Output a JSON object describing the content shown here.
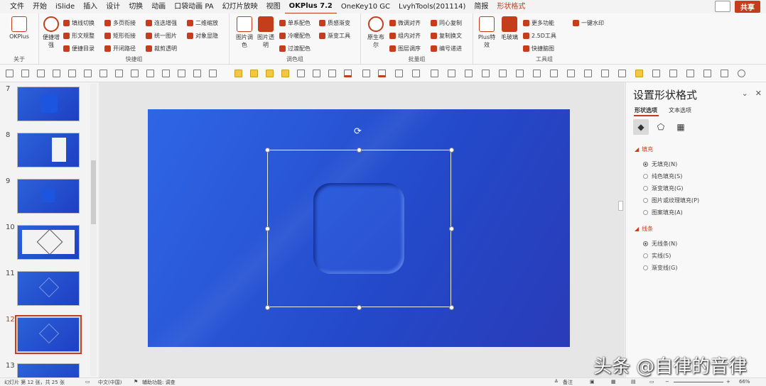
{
  "menu_tabs": [
    "文件",
    "开始",
    "iSlide",
    "插入",
    "设计",
    "切换",
    "动画",
    "口袋动画 PA",
    "幻灯片放映",
    "视图",
    "OKPlus 7.2",
    "OneKey10 GC",
    "LvyhTools(201114)",
    "简报",
    "形状格式"
  ],
  "share_label": "共享",
  "ribbon": {
    "about": {
      "okplus": "OKPlus",
      "label": "关于"
    },
    "shortcut": {
      "label": "快捷组",
      "big": "便捷增强",
      "items": [
        "填线切换",
        "形文规整",
        "便捷目录",
        "多页衔接",
        "矩形衔接",
        "开闭路径",
        "连选增强",
        "统一图片",
        "裁剪透明",
        "二维缩放",
        "对象显隐"
      ]
    },
    "color": {
      "label": "调色组",
      "big1": "图片调色",
      "big2": "图片透明",
      "items": [
        "单系配色",
        "冷暖配色",
        "过渡配色",
        "质感渐变",
        "渐变工具"
      ]
    },
    "batch": {
      "label": "批量组",
      "big": "原生布尔",
      "items": [
        "微调对齐",
        "组内对齐",
        "图层调序",
        "同心复制",
        "复制换文",
        "编号递进"
      ]
    },
    "tools": {
      "label": "工具组",
      "big1": "Plus特效",
      "big2": "毛玻璃",
      "items": [
        "更多功能",
        "2.5D工具",
        "快捷脑图",
        "一键水印"
      ]
    }
  },
  "thumbnails": [
    {
      "n": "7"
    },
    {
      "n": "8"
    },
    {
      "n": "9"
    },
    {
      "n": "10"
    },
    {
      "n": "11"
    },
    {
      "n": "12"
    },
    {
      "n": "13"
    }
  ],
  "pane": {
    "title": "设置形状格式",
    "tab_shape": "形状选项",
    "tab_text": "文本选项",
    "fill_label": "填充",
    "fill_options": [
      "无填充(N)",
      "纯色填充(S)",
      "渐变填充(G)",
      "图片或纹理填充(P)",
      "图案填充(A)"
    ],
    "line_label": "线条",
    "line_options": [
      "无线条(N)",
      "实线(S)",
      "渐变线(G)"
    ]
  },
  "status": {
    "slide": "幻灯片 第 12 张，共 25 张",
    "lang": "中文(中国)",
    "access": "辅助功能: 调查",
    "notes": "备注",
    "zoom": "66%"
  },
  "watermark": "头条 @自律的音律"
}
